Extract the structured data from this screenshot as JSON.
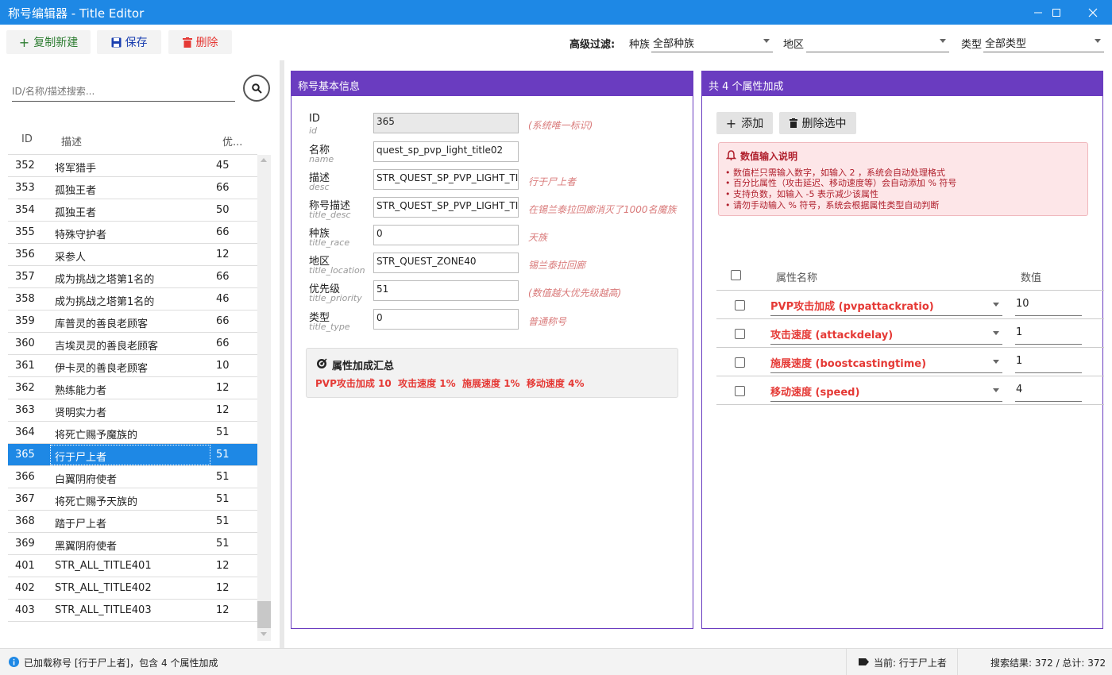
{
  "window": {
    "title": "称号编辑器 - Title Editor"
  },
  "toolbar": {
    "copy_new": "复制新建",
    "save": "保存",
    "delete": "删除",
    "filter_label": "高级过滤:",
    "race_label": "种族",
    "race_value": "全部种族",
    "zone_label": "地区",
    "zone_value": "",
    "type_label": "类型",
    "type_value": "全部类型"
  },
  "list": {
    "search_placeholder": "ID/名称/描述搜索...",
    "headers": {
      "id": "ID",
      "desc": "描述",
      "priority": "优..."
    },
    "rows": [
      {
        "id": "352",
        "desc": "将军猎手",
        "pri": "45"
      },
      {
        "id": "353",
        "desc": "孤独王者",
        "pri": "66"
      },
      {
        "id": "354",
        "desc": "孤独王者",
        "pri": "50"
      },
      {
        "id": "355",
        "desc": "特殊守护者",
        "pri": "66"
      },
      {
        "id": "356",
        "desc": "采参人",
        "pri": "12"
      },
      {
        "id": "357",
        "desc": "成为挑战之塔第1名的",
        "pri": "66"
      },
      {
        "id": "358",
        "desc": "成为挑战之塔第1名的",
        "pri": "46"
      },
      {
        "id": "359",
        "desc": "库普灵的善良老顾客",
        "pri": "66"
      },
      {
        "id": "360",
        "desc": "吉埃灵灵的善良老顾客",
        "pri": "66"
      },
      {
        "id": "361",
        "desc": "伊卡灵的善良老顾客",
        "pri": "10"
      },
      {
        "id": "362",
        "desc": "熟练能力者",
        "pri": "12"
      },
      {
        "id": "363",
        "desc": "贤明实力者",
        "pri": "12"
      },
      {
        "id": "364",
        "desc": "将死亡赐予魔族的",
        "pri": "51"
      },
      {
        "id": "365",
        "desc": "行于尸上者",
        "pri": "51"
      },
      {
        "id": "366",
        "desc": "白翼阴府使者",
        "pri": "51"
      },
      {
        "id": "367",
        "desc": "将死亡赐予天族的",
        "pri": "51"
      },
      {
        "id": "368",
        "desc": "踏于尸上者",
        "pri": "51"
      },
      {
        "id": "369",
        "desc": "黑翼阴府使者",
        "pri": "51"
      },
      {
        "id": "401",
        "desc": "STR_ALL_TITLE401",
        "pri": "12"
      },
      {
        "id": "402",
        "desc": "STR_ALL_TITLE402",
        "pri": "12"
      },
      {
        "id": "403",
        "desc": "STR_ALL_TITLE403",
        "pri": "12"
      }
    ]
  },
  "basic": {
    "header": "称号基本信息",
    "fields": [
      {
        "label": "ID",
        "sub": "id",
        "value": "365",
        "hint": "(系统唯一标识)"
      },
      {
        "label": "名称",
        "sub": "name",
        "value": "quest_sp_pvp_light_title02",
        "hint": ""
      },
      {
        "label": "描述",
        "sub": "desc",
        "value": "STR_QUEST_SP_PVP_LIGHT_TITLE",
        "hint": "行于尸上者"
      },
      {
        "label": "称号描述",
        "sub": "title_desc",
        "value": "STR_QUEST_SP_PVP_LIGHT_TITLE",
        "hint": "在锡兰泰拉回廊消灭了1000名魔族"
      },
      {
        "label": "种族",
        "sub": "title_race",
        "value": "0",
        "hint": "天族"
      },
      {
        "label": "地区",
        "sub": "title_location",
        "value": "STR_QUEST_ZONE40",
        "hint": "锡兰泰拉回廊"
      },
      {
        "label": "优先级",
        "sub": "title_priority",
        "value": "51",
        "hint": "(数值越大优先级越高)"
      },
      {
        "label": "类型",
        "sub": "title_type",
        "value": "0",
        "hint": "普通称号"
      }
    ],
    "summary_title": "属性加成汇总",
    "summary_text": "PVP攻击加成 10  攻击速度 1%  施展速度 1%  移动速度 4%"
  },
  "attrs": {
    "header": "共 4 个属性加成",
    "add": "添加",
    "delete_selected": "删除选中",
    "note_title": "数值输入说明",
    "notes": [
      "• 数值栏只需输入数字，如输入  2 ，系统会自动处理格式",
      "• 百分比属性（攻击延迟、移动速度等）会自动添加 % 符号",
      "• 支持负数，如输入  -5  表示减少该属性",
      "• 请勿手动输入 % 符号，系统会根据属性类型自动判断"
    ],
    "col_name": "属性名称",
    "col_value": "数值",
    "rows": [
      {
        "name": "PVP攻击加成 (pvpattackratio)",
        "value": "10"
      },
      {
        "name": "攻击速度 (attackdelay)",
        "value": "1"
      },
      {
        "name": "施展速度 (boostcastingtime)",
        "value": "1"
      },
      {
        "name": "移动速度 (speed)",
        "value": "4"
      }
    ]
  },
  "status": {
    "loaded": "已加载称号 [行于尸上者]，包含 4 个属性加成",
    "current": "当前: 行于尸上者",
    "results": "搜索结果: 372 / 总计: 372"
  },
  "colors": {
    "accent": "#1e88e5",
    "panel": "#6a3cc0",
    "danger": "#e53935",
    "success": "#2e7d32"
  }
}
